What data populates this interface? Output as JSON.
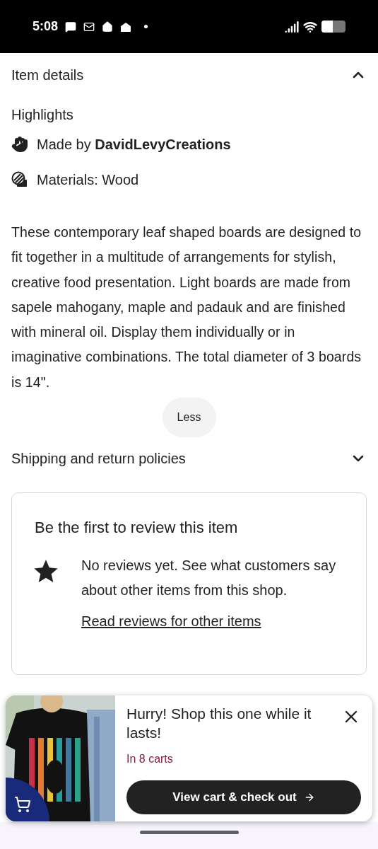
{
  "status_bar": {
    "time": "5:08"
  },
  "item_details": {
    "title": "Item details",
    "expanded": true,
    "highlights_title": "Highlights",
    "highlights": [
      {
        "kind": "maker",
        "text": "Made by **DavidLevyCreations**"
      },
      {
        "kind": "materials",
        "text": "Materials: Wood"
      }
    ],
    "description": "These contemporary leaf shaped boards are designed to fit together in a multitude of arrangements for stylish, creative food presentation. Light boards are made from sapele mahogany, maple and padauk and are finished with mineral oil. Display them individually or in imaginative combinations. The total diameter of 3 boards is 14\".",
    "toggle": "Less"
  },
  "shipping": {
    "title": "Shipping and return policies",
    "expanded": false
  },
  "reviews": {
    "title": "Be the first to review this item",
    "message": "No reviews yet. See what customers say about other items from this shop.",
    "link": "Read reviews for other items"
  },
  "cart_popup": {
    "title": "Hurry! Shop this one while it lasts!",
    "count": "In 8 carts",
    "button": "View cart & check out"
  }
}
